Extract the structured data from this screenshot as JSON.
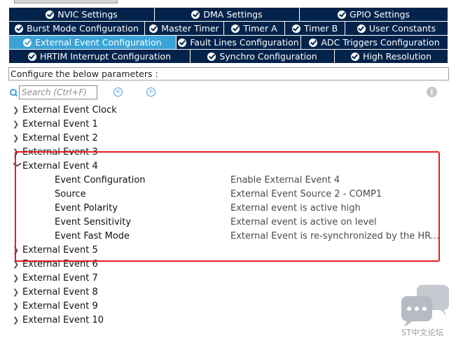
{
  "tabs": {
    "row1": [
      {
        "label": "NVIC Settings"
      },
      {
        "label": "DMA Settings"
      },
      {
        "label": "GPIO Settings"
      }
    ],
    "row2": [
      {
        "label": "Burst Mode Configuration"
      },
      {
        "label": "Master Timer"
      },
      {
        "label": "Timer A"
      },
      {
        "label": "Timer B"
      },
      {
        "label": "User Constants"
      }
    ],
    "row3": [
      {
        "label": "External Event Configuration",
        "active": true
      },
      {
        "label": "Fault Lines Configuration"
      },
      {
        "label": "ADC Triggers Configuration"
      }
    ],
    "row4": [
      {
        "label": "HRTIM Interrupt Configuration"
      },
      {
        "label": "Synchro Configuration"
      },
      {
        "label": "High Resolution"
      }
    ]
  },
  "hint": "Configure the below parameters :",
  "search": {
    "placeholder": "Search (Ctrl+F)"
  },
  "tree": [
    {
      "label": "External Event Clock",
      "expanded": false
    },
    {
      "label": "External Event 1",
      "expanded": false
    },
    {
      "label": "External Event 2",
      "expanded": false
    },
    {
      "label": "External Event 3",
      "expanded": false
    },
    {
      "label": "External Event 4",
      "expanded": true,
      "params": [
        {
          "name": "Event Configuration",
          "value": "Enable External Event 4"
        },
        {
          "name": "Source",
          "value": "External Event Source 2 - COMP1"
        },
        {
          "name": "Event Polarity",
          "value": "External event is active high"
        },
        {
          "name": "Event Sensitivity",
          "value": "External event is active on level"
        },
        {
          "name": "Event Fast Mode",
          "value": "External Event is re-synchronized by the HRTIM lo..."
        }
      ]
    },
    {
      "label": "External Event 5",
      "expanded": false
    },
    {
      "label": "External Event 6",
      "expanded": false
    },
    {
      "label": "External Event 7",
      "expanded": false
    },
    {
      "label": "External Event 8",
      "expanded": false
    },
    {
      "label": "External Event 9",
      "expanded": false
    },
    {
      "label": "External Event 10",
      "expanded": false
    }
  ],
  "watermark": "ST中文论坛",
  "colors": {
    "tab_bg": "#03234b",
    "tab_active": "#3ba3d6",
    "highlight": "#e02020"
  }
}
